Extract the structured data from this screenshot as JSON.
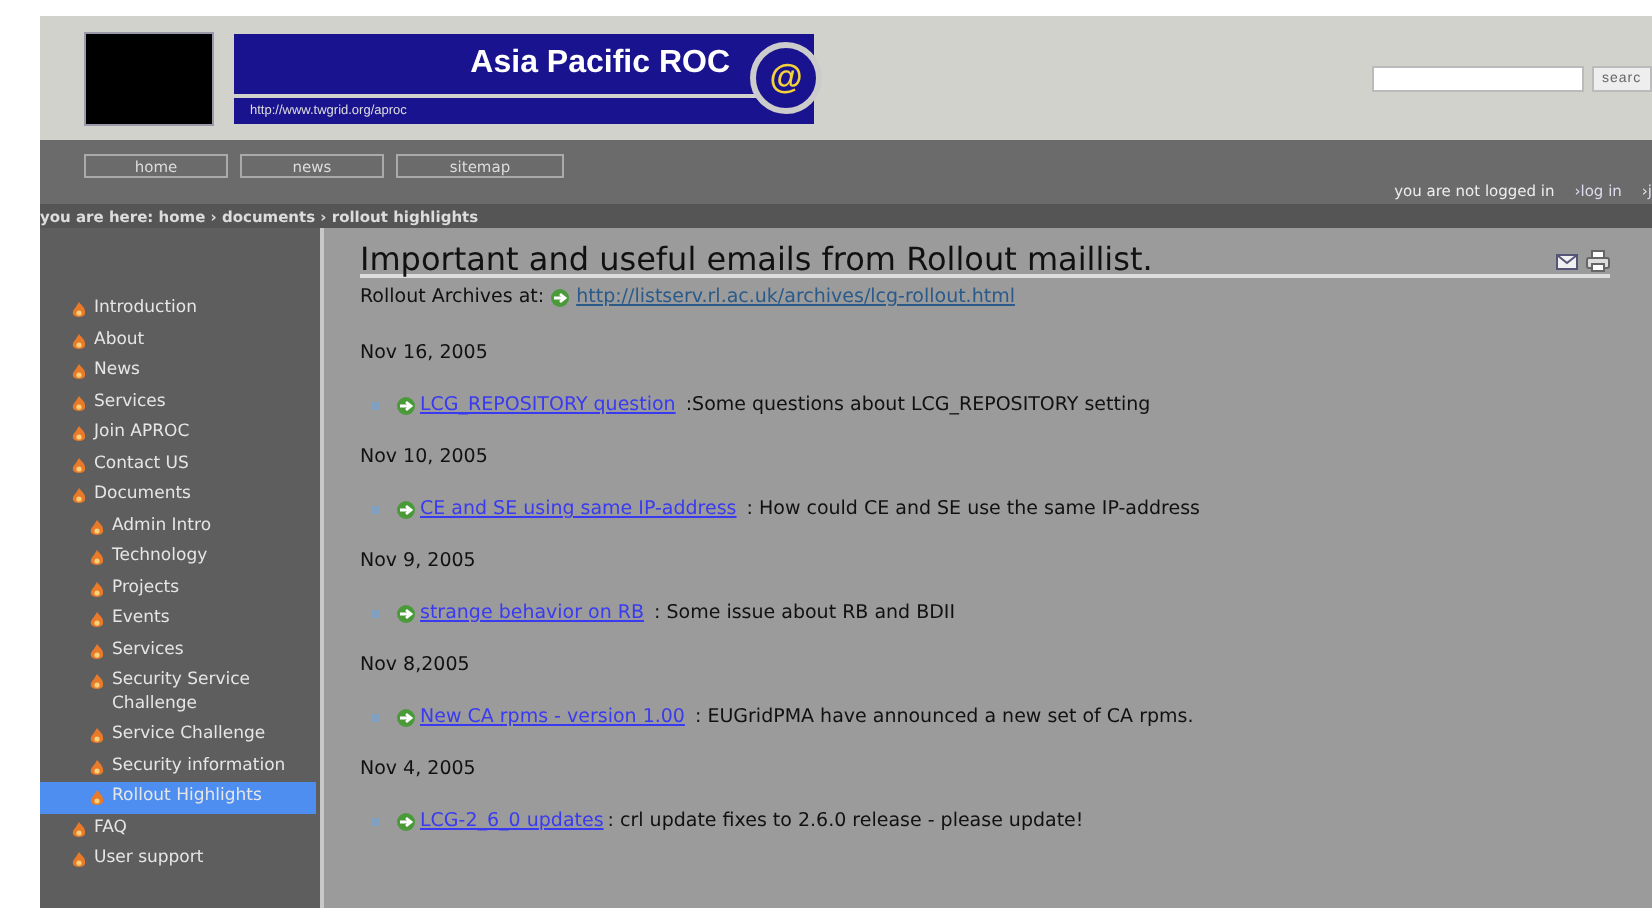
{
  "header": {
    "site_title": "Asia Pacific ROC",
    "site_url": "http://www.twgrid.org/aproc",
    "logo_mark": "@",
    "search": {
      "button": "searc"
    }
  },
  "nav": {
    "buttons": [
      "home",
      "news",
      "sitemap"
    ],
    "login_status": "you are not logged in",
    "links": [
      "›log in",
      "›j"
    ]
  },
  "breadcrumb": "you are here: home › documents › rollout highlights",
  "sidebar": {
    "items": [
      {
        "label": "Introduction",
        "selected": false
      },
      {
        "label": "About",
        "selected": false
      },
      {
        "label": "News",
        "selected": false
      },
      {
        "label": "Services",
        "selected": false
      },
      {
        "label": "Join APROC",
        "selected": false
      },
      {
        "label": "Contact US",
        "selected": false
      },
      {
        "label": "Documents",
        "selected": false,
        "children": [
          {
            "label": "Admin Intro",
            "selected": false
          },
          {
            "label": "Technology",
            "selected": false
          },
          {
            "label": "Projects",
            "selected": false
          },
          {
            "label": "Events",
            "selected": false
          },
          {
            "label": "Services",
            "selected": false
          },
          {
            "label": "Security Service Challenge",
            "selected": false
          },
          {
            "label": "Service Challenge",
            "selected": false
          },
          {
            "label": "Security information",
            "selected": false
          },
          {
            "label": "Rollout Highlights",
            "selected": true
          }
        ]
      },
      {
        "label": "FAQ",
        "selected": false
      },
      {
        "label": "User support",
        "selected": false
      }
    ]
  },
  "content": {
    "title": "Important and useful emails from Rollout maillist.",
    "archives_label": "Rollout Archives at:",
    "archives_link": "http://listserv.rl.ac.uk/archives/lcg-rollout.html",
    "entries": [
      {
        "date": "Nov 16, 2005",
        "link": "LCG_REPOSITORY question",
        "description": " :Some questions about LCG_REPOSITORY setting"
      },
      {
        "date": "Nov 10, 2005",
        "link": "CE and SE using same IP-address",
        "description": " : How could CE and SE use the same IP-address"
      },
      {
        "date": "Nov 9, 2005",
        "link": "strange behavior on RB",
        "description": " : Some issue about RB and BDII"
      },
      {
        "date": "Nov 8,2005",
        "link": "New CA rpms - version 1.00",
        "description": " : EUGridPMA have announced a new set of CA rpms."
      },
      {
        "date": "Nov 4, 2005",
        "link": "LCG-2_6_0 updates",
        "description": ": crl update fixes to 2.6.0 release - please update!"
      }
    ]
  }
}
